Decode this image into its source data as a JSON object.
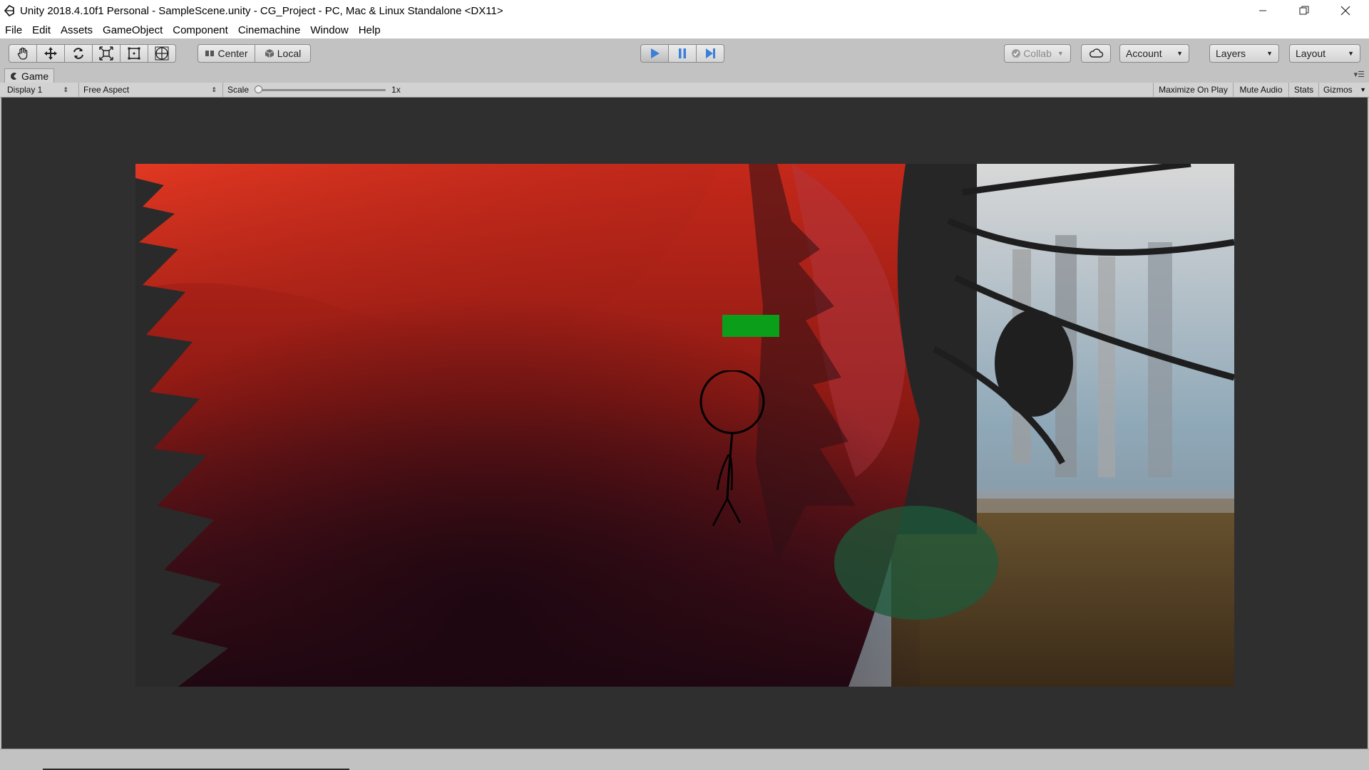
{
  "window": {
    "title": "Unity 2018.4.10f1 Personal - SampleScene.unity - CG_Project - PC, Mac & Linux Standalone <DX11>"
  },
  "menu": [
    "File",
    "Edit",
    "Assets",
    "GameObject",
    "Component",
    "Cinemachine",
    "Window",
    "Help"
  ],
  "toolbar": {
    "tools": [
      "hand-tool-icon",
      "move-tool-icon",
      "rotate-tool-icon",
      "scale-tool-icon",
      "rect-tool-icon",
      "transform-tool-icon"
    ],
    "pivot_label": "Center",
    "space_label": "Local",
    "collab_label": "Collab",
    "account_label": "Account",
    "layers_label": "Layers",
    "layout_label": "Layout",
    "play_active": true
  },
  "game_view": {
    "tab_label": "Game",
    "display": "Display 1",
    "aspect": "Free Aspect",
    "scale_label": "Scale",
    "scale_value": "1x",
    "maximize_label": "Maximize On Play",
    "mute_label": "Mute Audio",
    "stats_label": "Stats",
    "gizmos_label": "Gizmos"
  },
  "colors": {
    "play_active": "#5b8ed6",
    "health_bar": "#0a9e1a",
    "panel": "#c2c2c2",
    "viewport_bg": "#2f2f2f"
  }
}
